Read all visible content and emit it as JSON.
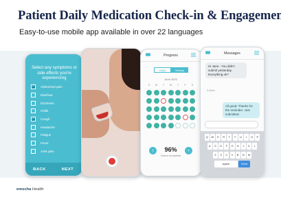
{
  "header": {
    "title": "Patient Daily Medication Check-in & Engagement",
    "subtitle": "Easy-to-use mobile app available in over 22 languages"
  },
  "phone_symptoms": {
    "prompt": "Select any symptoms or side effects you're experiencing",
    "options": [
      {
        "label": "Abdominal pain",
        "checked": true
      },
      {
        "label": "Diarrhea",
        "checked": false
      },
      {
        "label": "Dizziness",
        "checked": false
      },
      {
        "label": "Chills",
        "checked": false
      },
      {
        "label": "Cough",
        "checked": true
      },
      {
        "label": "Headache",
        "checked": false
      },
      {
        "label": "Fatigue",
        "checked": false
      },
      {
        "label": "Fever",
        "checked": false
      },
      {
        "label": "Joint pain",
        "checked": false
      }
    ],
    "back_label": "BACK",
    "next_label": "NEXT"
  },
  "phone_progress": {
    "title": "Progress",
    "segments": [
      "Daily",
      "Weekly"
    ],
    "month": "June 2020",
    "weekdays": [
      "S",
      "M",
      "T",
      "W",
      "T",
      "F",
      "S"
    ],
    "days": [
      "done",
      "done",
      "done",
      "done",
      "done",
      "done",
      "done",
      "done",
      "done",
      "missed",
      "done",
      "done",
      "done",
      "done",
      "done",
      "done",
      "done",
      "done",
      "done",
      "done",
      "done",
      "done",
      "done",
      "done",
      "done",
      "done",
      "missed",
      "done",
      "done",
      "done",
      "done",
      "done",
      "future",
      "future",
      "future"
    ],
    "completion": "96%",
    "completion_label": "Doses completed"
  },
  "phone_messages": {
    "title": "Messages",
    "incoming": "Hi Jane - You didn't submit yesterday. Everything ok?",
    "incoming_time": "9:40am",
    "outgoing": "All good. Thanks for the reminder. Just submitted.",
    "outgoing_time": "9:41am",
    "keyboard_rows": [
      [
        "Q",
        "W",
        "E",
        "R",
        "T",
        "Y",
        "U",
        "I",
        "O",
        "P"
      ],
      [
        "A",
        "S",
        "D",
        "F",
        "G",
        "H",
        "J",
        "K",
        "L"
      ],
      [
        "Z",
        "X",
        "C",
        "V",
        "B",
        "N",
        "M"
      ]
    ],
    "space_label": "space",
    "send_label": "Send"
  },
  "footer": {
    "logo_name": "emocha",
    "logo_suffix": "Health"
  },
  "colors": {
    "accent": "#4bbdd0",
    "title": "#17264a",
    "done": "#3fb3a4",
    "missed": "#e05b5b"
  }
}
